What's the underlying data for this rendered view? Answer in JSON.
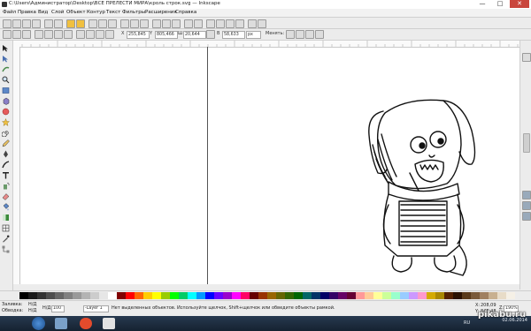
{
  "window": {
    "title": "C:\\Users\\Администратор\\Desktop\\ВСЕ ПРЕЛЕСТИ МИРА\\кроль строк.svg — Inkscape",
    "minimize": "—",
    "maximize": "□",
    "close": "✕"
  },
  "menu": [
    "Файл",
    "Правка",
    "Вид",
    "Слой",
    "Объект",
    "Контур",
    "Текст",
    "Фильтры",
    "Расширения",
    "Справка"
  ],
  "controls": {
    "x_label": "X",
    "x_value": "255,845",
    "y_label": "Y",
    "y_value": "805,466",
    "w_label": "Ш",
    "w_value": "20,644",
    "h_label": "В",
    "h_value": "58,633",
    "unit": "px",
    "transform_label": "Менять:"
  },
  "status": {
    "fill_label": "Заливка:",
    "fill_value": "Н/Д",
    "stroke_label": "Обводка:",
    "stroke_value": "Н/Д",
    "opacity_label": "Н/Д",
    "opacity_value": "100",
    "layer": "-Layer 1",
    "message": "Нет выделенных объектов. Используйте щелчок, Shift+щелчок или обведите объекты рамкой.",
    "x_label": "X:",
    "x_coord": "208,09",
    "y_label": "Y:",
    "y_coord": "845,48",
    "zoom_label": "Z:",
    "zoom": "190%"
  },
  "taskbar": {
    "time": "",
    "date": "02.06.2014",
    "lang": "RU"
  },
  "watermark": "pikabu.ru",
  "colors": {
    "accent_close": "#c9463d",
    "taskbar": "#1d2d40"
  }
}
